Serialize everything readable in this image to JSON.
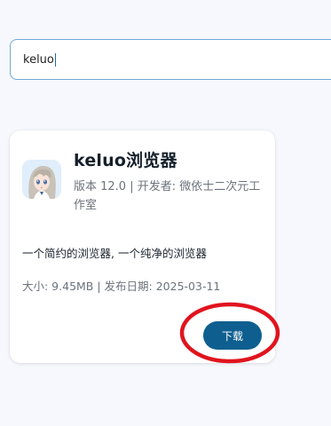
{
  "search": {
    "value": "keluo"
  },
  "app": {
    "name": "keluo浏览器",
    "meta": "版本 12.0 | 开发者: 微依士二次元工作室",
    "description": "一个简约的浏览器, 一个纯净的浏览器",
    "info": "大小: 9.45MB | 发布日期: 2025-03-11",
    "download_label": "下载",
    "icon": "anime-character-icon"
  },
  "colors": {
    "accent": "#0e5f8f",
    "search_border": "#6fa8d8",
    "annotation": "#e0141e",
    "background": "#f6f8fd"
  }
}
